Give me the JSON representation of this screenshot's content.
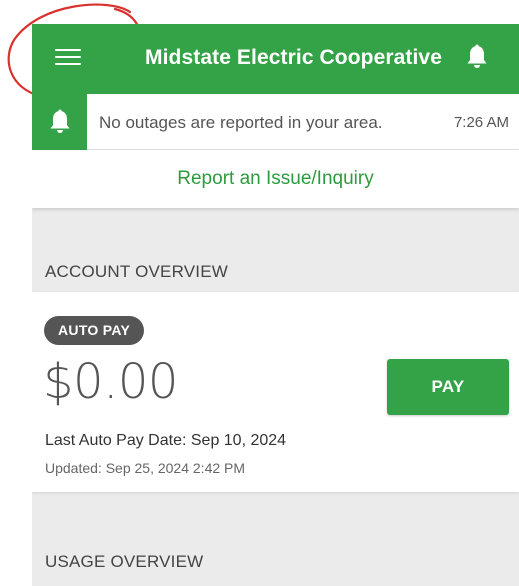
{
  "app": {
    "title": "Midstate Electric Cooperative",
    "brand_color": "#34a347"
  },
  "icons": {
    "menu": "menu-icon",
    "bell": "bell-icon"
  },
  "alert": {
    "message": "No outages are reported in your area.",
    "time": "7:26 AM"
  },
  "report": {
    "label": "Report an Issue/Inquiry"
  },
  "account_overview": {
    "heading": "ACCOUNT OVERVIEW",
    "badge": "AUTO PAY",
    "amount": "$0.00",
    "pay_label": "PAY",
    "last_auto_pay": "Last Auto Pay Date: Sep 10, 2024",
    "updated": "Updated:  Sep 25, 2024 2:42 PM"
  },
  "usage_overview": {
    "heading": "USAGE OVERVIEW"
  }
}
